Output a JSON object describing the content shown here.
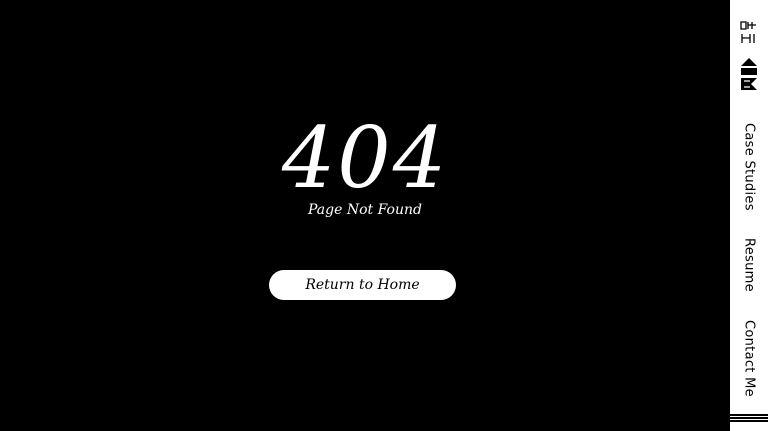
{
  "error": {
    "code": "404",
    "message": "Page Not Found"
  },
  "actions": {
    "home_label": "Return to Home"
  },
  "sidebar": {
    "logo": "54 AR",
    "items": [
      {
        "label": "Case Studies"
      },
      {
        "label": "Resume"
      },
      {
        "label": "Contact Me"
      }
    ]
  },
  "colors": {
    "background": "#000000",
    "foreground": "#ffffff",
    "sidebar": "#ffffff",
    "sidebar_text": "#000000"
  }
}
